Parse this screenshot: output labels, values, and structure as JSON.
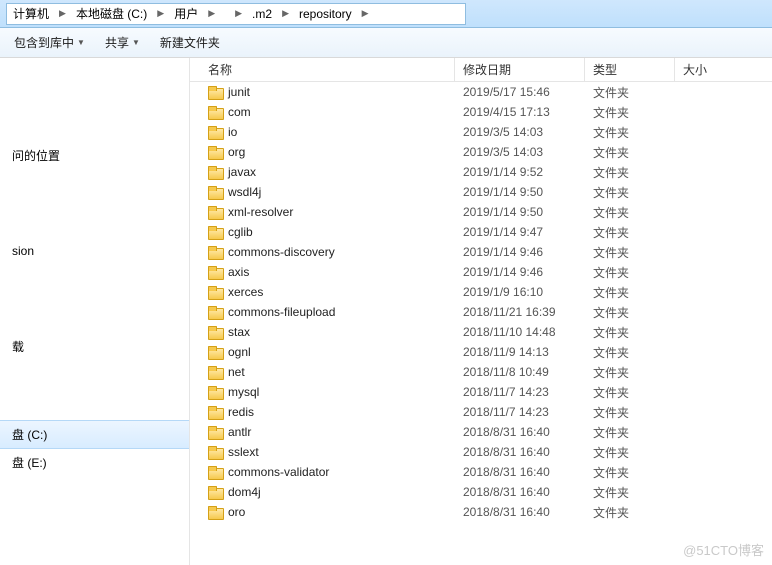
{
  "breadcrumb": [
    {
      "label": "计算机"
    },
    {
      "label": "本地磁盘 (C:)"
    },
    {
      "label": "用户"
    },
    {
      "label": ""
    },
    {
      "label": ".m2"
    },
    {
      "label": "repository"
    }
  ],
  "toolbar": {
    "include_label": "包含到库中",
    "share_label": "共享",
    "new_folder_label": "新建文件夹"
  },
  "sidebar": {
    "items": [
      {
        "label": "问的位置"
      },
      {
        "label": "sion"
      },
      {
        "label": "载"
      },
      {
        "label": "盘 (C:)",
        "selected": true
      },
      {
        "label": "盘 (E:)"
      }
    ]
  },
  "columns": {
    "name": "名称",
    "date": "修改日期",
    "type": "类型",
    "size": "大小"
  },
  "type_folder": "文件夹",
  "files": [
    {
      "name": "junit",
      "date": "2019/5/17 15:46"
    },
    {
      "name": "com",
      "date": "2019/4/15 17:13"
    },
    {
      "name": "io",
      "date": "2019/3/5 14:03"
    },
    {
      "name": "org",
      "date": "2019/3/5 14:03"
    },
    {
      "name": "javax",
      "date": "2019/1/14 9:52"
    },
    {
      "name": "wsdl4j",
      "date": "2019/1/14 9:50"
    },
    {
      "name": "xml-resolver",
      "date": "2019/1/14 9:50"
    },
    {
      "name": "cglib",
      "date": "2019/1/14 9:47"
    },
    {
      "name": "commons-discovery",
      "date": "2019/1/14 9:46"
    },
    {
      "name": "axis",
      "date": "2019/1/14 9:46"
    },
    {
      "name": "xerces",
      "date": "2019/1/9 16:10"
    },
    {
      "name": "commons-fileupload",
      "date": "2018/11/21 16:39"
    },
    {
      "name": "stax",
      "date": "2018/11/10 14:48"
    },
    {
      "name": "ognl",
      "date": "2018/11/9 14:13"
    },
    {
      "name": "net",
      "date": "2018/11/8 10:49"
    },
    {
      "name": "mysql",
      "date": "2018/11/7 14:23"
    },
    {
      "name": "redis",
      "date": "2018/11/7 14:23"
    },
    {
      "name": "antlr",
      "date": "2018/8/31 16:40"
    },
    {
      "name": "sslext",
      "date": "2018/8/31 16:40"
    },
    {
      "name": "commons-validator",
      "date": "2018/8/31 16:40"
    },
    {
      "name": "dom4j",
      "date": "2018/8/31 16:40"
    },
    {
      "name": "oro",
      "date": "2018/8/31 16:40"
    }
  ],
  "watermark": "@51CTO博客"
}
